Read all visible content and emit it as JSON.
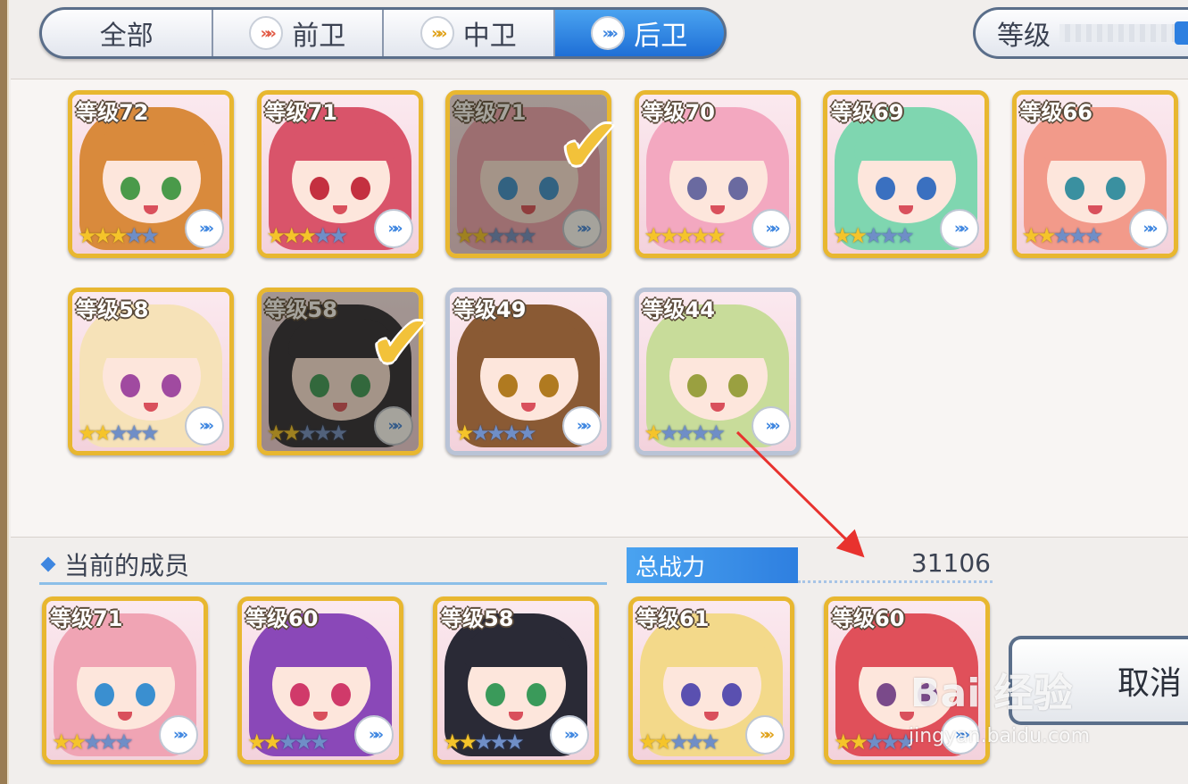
{
  "tabs": [
    {
      "label": "全部",
      "icon": "",
      "active": false
    },
    {
      "label": "前卫",
      "icon": "front-role-icon",
      "active": false
    },
    {
      "label": "中卫",
      "icon": "mid-role-icon",
      "active": false
    },
    {
      "label": "后卫",
      "icon": "back-role-icon",
      "active": true
    }
  ],
  "sort": {
    "label": "等级"
  },
  "roster": [
    {
      "level": "等级72",
      "stars_on": 3,
      "stars_total": 5,
      "selected": false,
      "frame": "gold",
      "hair": "#d98a3c",
      "eyes": "#4a9a4a"
    },
    {
      "level": "等级71",
      "stars_on": 3,
      "stars_total": 5,
      "selected": false,
      "frame": "gold",
      "hair": "#d9546a",
      "eyes": "#c43040"
    },
    {
      "level": "等级71",
      "stars_on": 2,
      "stars_total": 5,
      "selected": true,
      "frame": "gold",
      "hair": "#f0a4b4",
      "eyes": "#3a8fd0"
    },
    {
      "level": "等级70",
      "stars_on": 5,
      "stars_total": 5,
      "selected": false,
      "frame": "gold",
      "hair": "#f3a8c0",
      "eyes": "#6a6aa0"
    },
    {
      "level": "等级69",
      "stars_on": 2,
      "stars_total": 5,
      "selected": false,
      "frame": "gold",
      "hair": "#7fd6b0",
      "eyes": "#3a70c0"
    },
    {
      "level": "等级66",
      "stars_on": 2,
      "stars_total": 5,
      "selected": false,
      "frame": "gold",
      "hair": "#f29a8a",
      "eyes": "#3a90a0"
    },
    {
      "level": "等级58",
      "stars_on": 2,
      "stars_total": 5,
      "selected": false,
      "frame": "gold",
      "hair": "#f6e2b8",
      "eyes": "#a04aa0"
    },
    {
      "level": "等级58",
      "stars_on": 2,
      "stars_total": 5,
      "selected": true,
      "frame": "gold",
      "hair": "#2a2a36",
      "eyes": "#3a9a5a"
    },
    {
      "level": "等级49",
      "stars_on": 1,
      "stars_total": 5,
      "selected": false,
      "frame": "silver",
      "hair": "#8a5a34",
      "eyes": "#b07a20"
    },
    {
      "level": "等级44",
      "stars_on": 1,
      "stars_total": 5,
      "selected": false,
      "frame": "silver",
      "hair": "#c8dc9a",
      "eyes": "#9aa040"
    }
  ],
  "members_title": "当前的成员",
  "power": {
    "label": "总战力",
    "value": "31106"
  },
  "members": [
    {
      "level": "等级71",
      "stars_on": 2,
      "stars_total": 5,
      "role": "back",
      "hair": "#f0a4b4",
      "eyes": "#3a8fd0"
    },
    {
      "level": "等级60",
      "stars_on": 2,
      "stars_total": 5,
      "role": "back",
      "hair": "#8a48b8",
      "eyes": "#d03a6a"
    },
    {
      "level": "等级58",
      "stars_on": 2,
      "stars_total": 5,
      "role": "back",
      "hair": "#2a2a36",
      "eyes": "#3a9a5a"
    },
    {
      "level": "等级61",
      "stars_on": 2,
      "stars_total": 5,
      "role": "mid",
      "hair": "#f3d98a",
      "eyes": "#5a50b0"
    },
    {
      "level": "等级60",
      "stars_on": 2,
      "stars_total": 5,
      "role": "back",
      "hair": "#e0505a",
      "eyes": "#7a4a8a"
    }
  ],
  "cancel_label": "取消",
  "watermark": {
    "main": "Bai 经验",
    "sub": "jingyan.baidu.com"
  }
}
